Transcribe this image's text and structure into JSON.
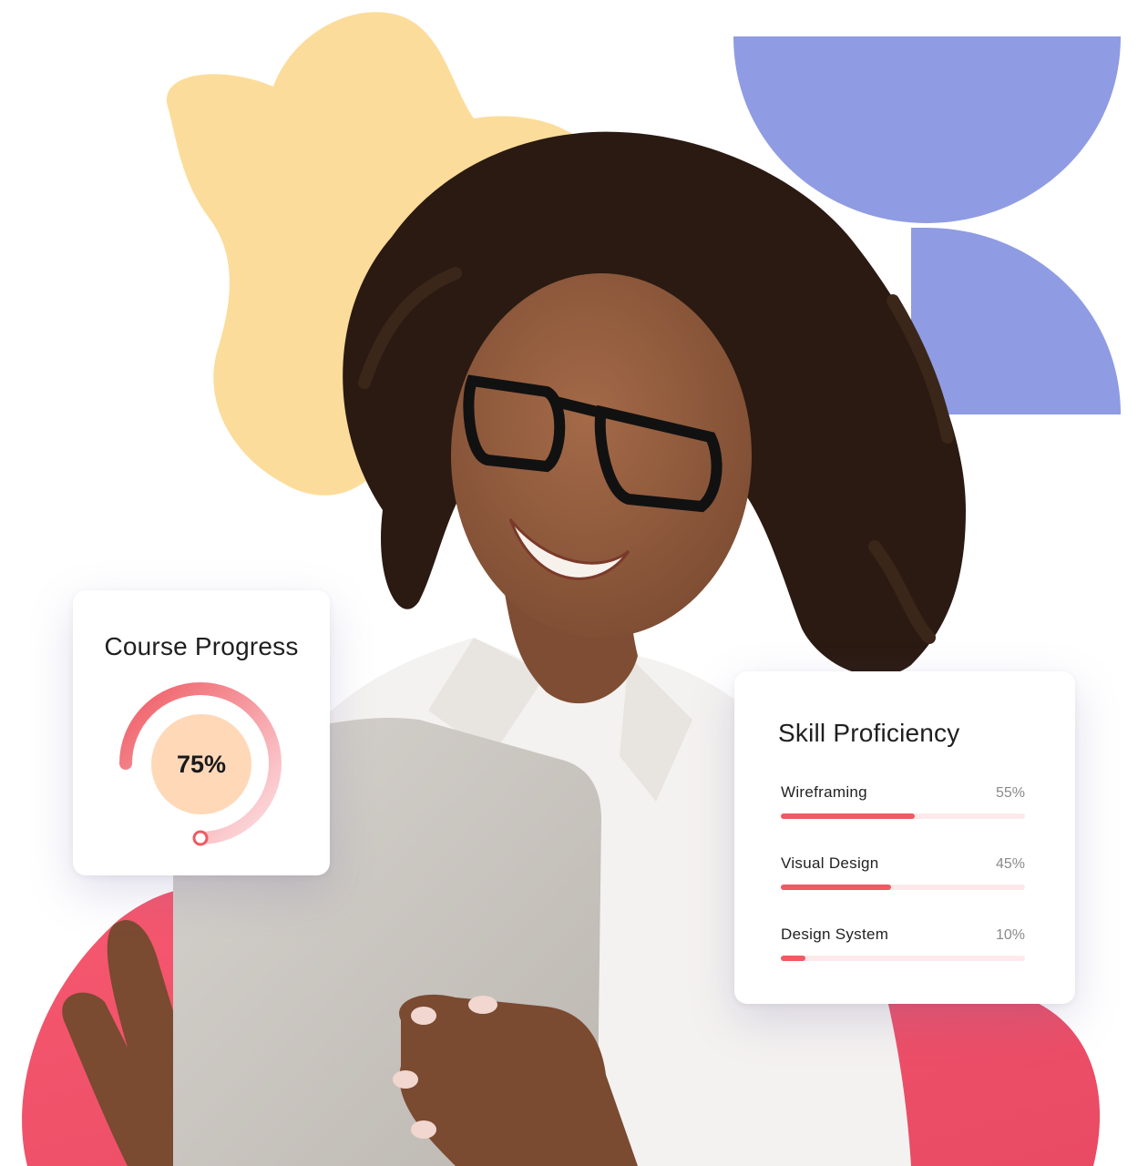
{
  "colors": {
    "yellow_blob": "#fcdc9a",
    "blue_shape": "#8f9ce3",
    "pink_blob": "#f3566f",
    "accent_red": "#ef5a63",
    "gauge_center": "#ffd8b8",
    "skin": "#8a5a3e",
    "hair": "#2a1a12",
    "shirt": "#f4f2f0",
    "tablet": "#c9c5c0"
  },
  "course_progress": {
    "title": "Course Progress",
    "value": 75,
    "label": "75%"
  },
  "skill_proficiency": {
    "title": "Skill Proficiency",
    "skills": [
      {
        "name": "Wireframing",
        "value": 55,
        "label": "55%"
      },
      {
        "name": "Visual Design",
        "value": 45,
        "label": "45%"
      },
      {
        "name": "Design System",
        "value": 10,
        "label": "10%"
      }
    ]
  }
}
